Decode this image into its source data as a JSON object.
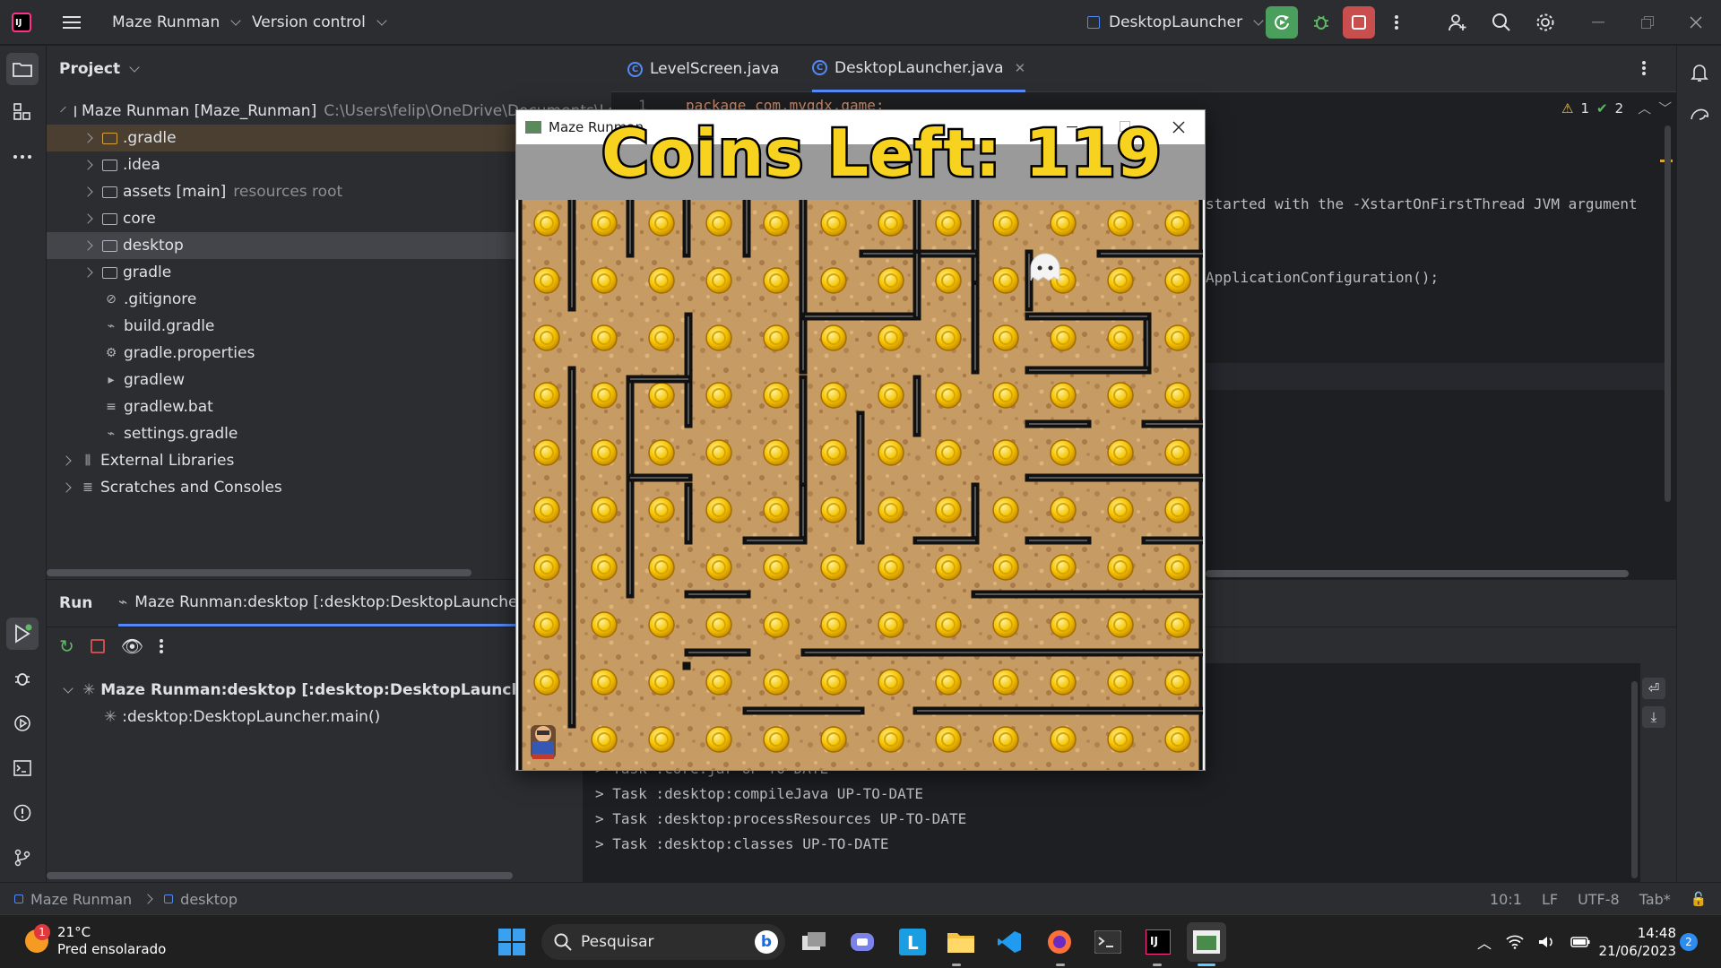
{
  "topbar": {
    "project_name": "Maze Runman",
    "vcs": "Version control",
    "run_config": "DesktopLauncher"
  },
  "project_panel": {
    "title": "Project",
    "root": {
      "name": "Maze Runman [Maze_Runman]",
      "path": "C:\\Users\\felip\\OneDrive\\Documents\\Lo"
    },
    "items": [
      {
        "label": ".gradle",
        "extra": ""
      },
      {
        "label": ".idea",
        "extra": ""
      },
      {
        "label": "assets [main]",
        "extra": "resources root"
      },
      {
        "label": "core",
        "extra": ""
      },
      {
        "label": "desktop",
        "extra": ""
      },
      {
        "label": "gradle",
        "extra": ""
      },
      {
        "label": ".gitignore",
        "extra": ""
      },
      {
        "label": "build.gradle",
        "extra": ""
      },
      {
        "label": "gradle.properties",
        "extra": ""
      },
      {
        "label": "gradlew",
        "extra": ""
      },
      {
        "label": "gradlew.bat",
        "extra": ""
      },
      {
        "label": "settings.gradle",
        "extra": ""
      },
      {
        "label": "External Libraries",
        "extra": ""
      },
      {
        "label": "Scratches and Consoles",
        "extra": ""
      }
    ]
  },
  "editor": {
    "tabs": [
      {
        "label": "LevelScreen.java"
      },
      {
        "label": "DesktopLauncher.java"
      }
    ],
    "line_no": "1",
    "code_line1": "package com.mygdx.game;",
    "code_comment": "started with the -XstartOnFirstThread JVM argument",
    "code_config": "ApplicationConfiguration();",
    "warnings": "1",
    "checks": "2"
  },
  "run_panel": {
    "title": "Run",
    "tab_label": "Maze Runman:desktop [:desktop:DesktopLauncher.ma",
    "tree_root": "Maze Runman:desktop [:desktop:DesktopLauncher.ma",
    "tree_child": ":desktop:DesktopLauncher.main()",
    "console": [
      "> Task :core:jar UP-TO-DATE",
      "> Task :desktop:compileJava UP-TO-DATE",
      "> Task :desktop:processResources UP-TO-DATE",
      "> Task :desktop:classes UP-TO-DATE"
    ]
  },
  "statusbar": {
    "crumb1": "Maze Runman",
    "crumb2": "desktop",
    "position": "10:1",
    "line_sep": "LF",
    "encoding": "UTF-8",
    "indent": "Tab*"
  },
  "game": {
    "title": "Maze Runman",
    "coins_label": "Coins Left: 119"
  },
  "taskbar": {
    "temp": "21°C",
    "weather": "Pred ensolarado",
    "weather_badge": "1",
    "search_placeholder": "Pesquisar",
    "time": "14:48",
    "date": "21/06/2023",
    "notif": "2"
  },
  "colors": {
    "ide_bg": "#1e1f22",
    "panel_bg": "#2b2d30",
    "accent_blue": "#548af7",
    "run_green": "#4a9f5c",
    "stop_red": "#c94f4f",
    "coin_yellow": "#f7d21e",
    "maze_sand": "#c49a62"
  }
}
